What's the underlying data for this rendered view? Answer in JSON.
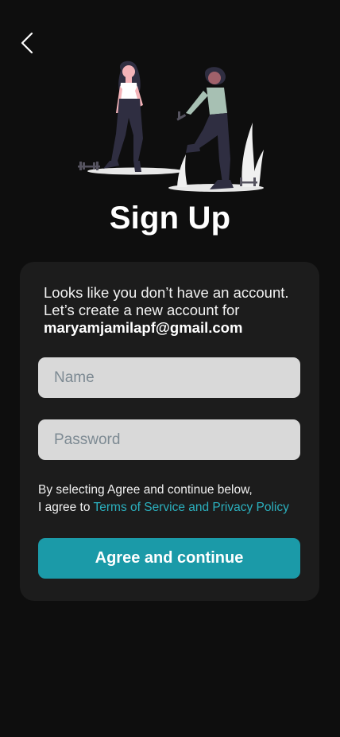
{
  "header": {
    "back_icon": "chevron-left-icon",
    "title": "Sign Up"
  },
  "card": {
    "intro_line1": "Looks like you don’t have an account.",
    "intro_line2": "Let’s create a new account for",
    "email": "maryamjamilapf@gmail.com",
    "name_placeholder": "Name",
    "password_placeholder": "Password",
    "terms_line1": "By selecting Agree and continue below,",
    "terms_prefix": "I agree to ",
    "terms_link": "Terms of Service and Privacy Policy",
    "agree_label": "Agree and continue"
  },
  "colors": {
    "background": "#0e0e0e",
    "card": "#1c1c1c",
    "input": "#d9d9d9",
    "accent": "#1b9aa8",
    "link": "#2bb0be"
  }
}
